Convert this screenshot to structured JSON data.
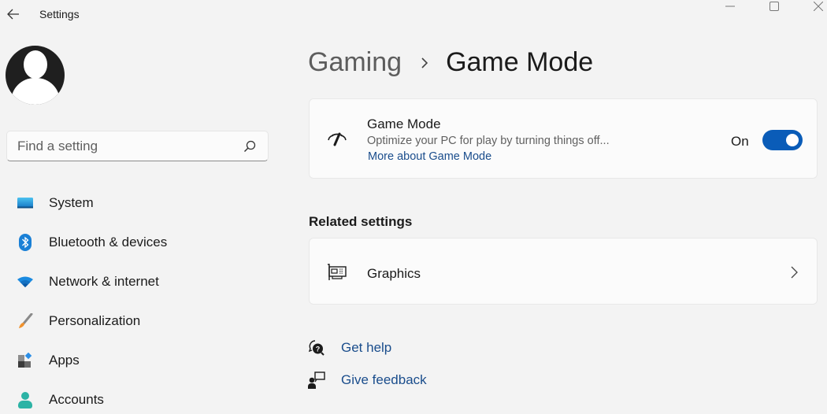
{
  "window": {
    "title": "Settings",
    "controls": {
      "minimize": "minimize-icon",
      "maximize": "maximize-icon",
      "close": "close-icon"
    }
  },
  "sidebar": {
    "search": {
      "placeholder": "Find a setting",
      "value": ""
    },
    "items": [
      {
        "label": "System",
        "icon": "system-icon"
      },
      {
        "label": "Bluetooth & devices",
        "icon": "bluetooth-icon"
      },
      {
        "label": "Network & internet",
        "icon": "wifi-icon"
      },
      {
        "label": "Personalization",
        "icon": "brush-icon"
      },
      {
        "label": "Apps",
        "icon": "apps-icon"
      },
      {
        "label": "Accounts",
        "icon": "account-icon"
      }
    ]
  },
  "main": {
    "breadcrumb": {
      "parent": "Gaming",
      "current": "Game Mode"
    },
    "game_mode_card": {
      "title": "Game Mode",
      "description": "Optimize your PC for play by turning things off...",
      "link": "More about Game Mode",
      "toggle_state_label": "On",
      "toggle_on": true
    },
    "related": {
      "heading": "Related settings",
      "items": [
        {
          "label": "Graphics",
          "icon": "graphics-card-icon"
        }
      ]
    },
    "help": {
      "get_help": "Get help",
      "give_feedback": "Give feedback"
    }
  },
  "colors": {
    "accent": "#0a5cb8",
    "link": "#1a4d8c",
    "background": "#f3f3f3",
    "card": "#fbfbfb"
  }
}
